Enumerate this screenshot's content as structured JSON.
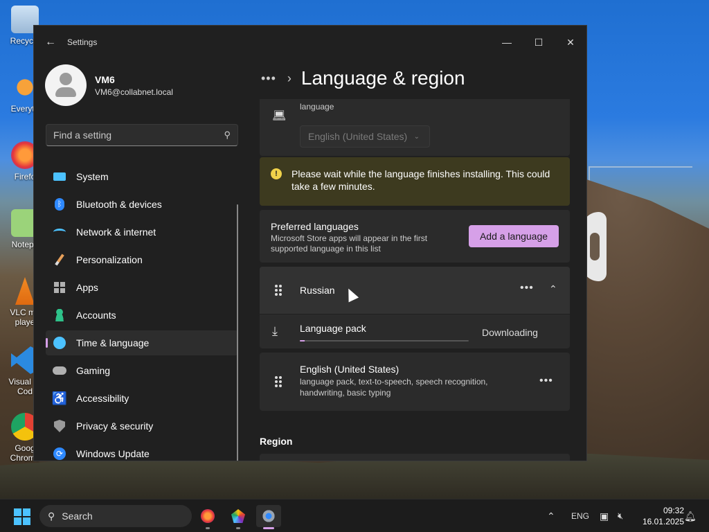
{
  "desktop": {
    "icons": [
      {
        "label": "Recycle",
        "name": "recycle-bin"
      },
      {
        "label": "Everyth",
        "name": "everything"
      },
      {
        "label": "Firefo",
        "name": "firefox"
      },
      {
        "label": "Notepa",
        "name": "notepad"
      },
      {
        "label": "VLC me\nplaye",
        "name": "vlc"
      },
      {
        "label": "Visual St\nCod",
        "name": "vscode"
      },
      {
        "label": "Goog\nChrome",
        "name": "chrome"
      }
    ]
  },
  "window": {
    "title": "Settings",
    "controls": {
      "minimize": "—",
      "maximize": "☐",
      "close": "✕"
    }
  },
  "profile": {
    "name": "VM6",
    "email": "VM6@collabnet.local"
  },
  "search": {
    "placeholder": "Find a setting"
  },
  "nav": [
    {
      "label": "System",
      "icon": "monitor-icon",
      "color": "#4cc2ff"
    },
    {
      "label": "Bluetooth & devices",
      "icon": "bluetooth-icon",
      "color": "#2e89ff"
    },
    {
      "label": "Network & internet",
      "icon": "wifi-icon",
      "color": "#4cc2ff"
    },
    {
      "label": "Personalization",
      "icon": "brush-icon",
      "color": "#e8a05a"
    },
    {
      "label": "Apps",
      "icon": "apps-icon",
      "color": "#b0b0b0"
    },
    {
      "label": "Accounts",
      "icon": "person-icon",
      "color": "#2ec28a"
    },
    {
      "label": "Time & language",
      "icon": "globe-clock-icon",
      "color": "#4cc2ff",
      "active": true
    },
    {
      "label": "Gaming",
      "icon": "gamepad-icon",
      "color": "#b0b0b0"
    },
    {
      "label": "Accessibility",
      "icon": "accessibility-icon",
      "color": "#3ea6ff"
    },
    {
      "label": "Privacy & security",
      "icon": "shield-icon",
      "color": "#9a9a9a"
    },
    {
      "label": "Windows Update",
      "icon": "update-icon",
      "color": "#2e89ff"
    }
  ],
  "content": {
    "breadcrumb_dots": "•••",
    "breadcrumb_sep": "›",
    "title": "Language & region",
    "display_language": {
      "partial_label": "language",
      "value": "English (United States)"
    },
    "warning": "Please wait while the language finishes installing. This could take a few minutes.",
    "preferred": {
      "title": "Preferred languages",
      "description": "Microsoft Store apps will appear in the first supported language in this list",
      "add_button": "Add a language"
    },
    "languages": [
      {
        "name": "Russian",
        "pack_label": "Language pack",
        "pack_status": "Downloading",
        "pack_progress": 0.03
      },
      {
        "name": "English (United States)",
        "description": "language pack, text-to-speech, speech recognition, handwriting, basic typing"
      }
    ],
    "region_heading": "Region"
  },
  "taskbar": {
    "search_label": "Search",
    "tray": {
      "lang": "ENG",
      "time": "09:32",
      "date": "16.01.2025"
    },
    "accent": "#d6a0e8"
  }
}
